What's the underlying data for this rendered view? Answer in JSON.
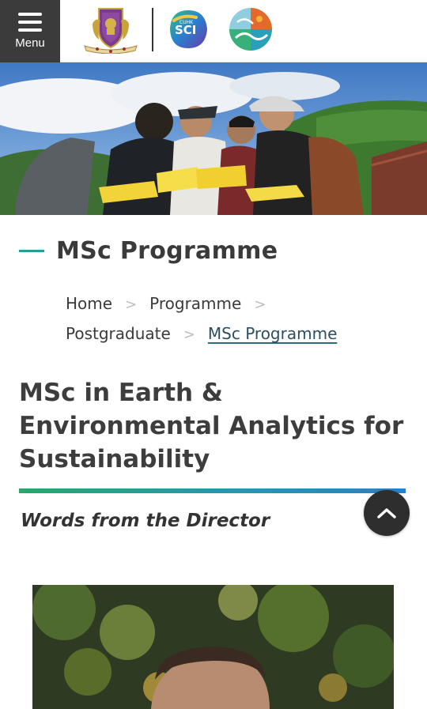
{
  "header": {
    "menu_label": "Menu",
    "logos": [
      "cuhk-crest-icon",
      "cuhk-sci-logo-icon",
      "earth-system-logo-icon"
    ],
    "sci_logo_text": "SCI",
    "sci_logo_small_text": "CUHK"
  },
  "section": {
    "title": "MSc Programme"
  },
  "breadcrumb": {
    "items": [
      "Home",
      "Programme",
      "Postgraduate",
      "MSc Programme"
    ],
    "separator": ">"
  },
  "page": {
    "heading": "MSc in Earth & Environmental Analytics for Sustainability",
    "subheading": "Words from the Director"
  },
  "colors": {
    "accent_teal": "#2a9d9a",
    "dark": "#3b3b3b",
    "gradient_start": "#2ba66c",
    "gradient_end": "#2c7fc4"
  }
}
